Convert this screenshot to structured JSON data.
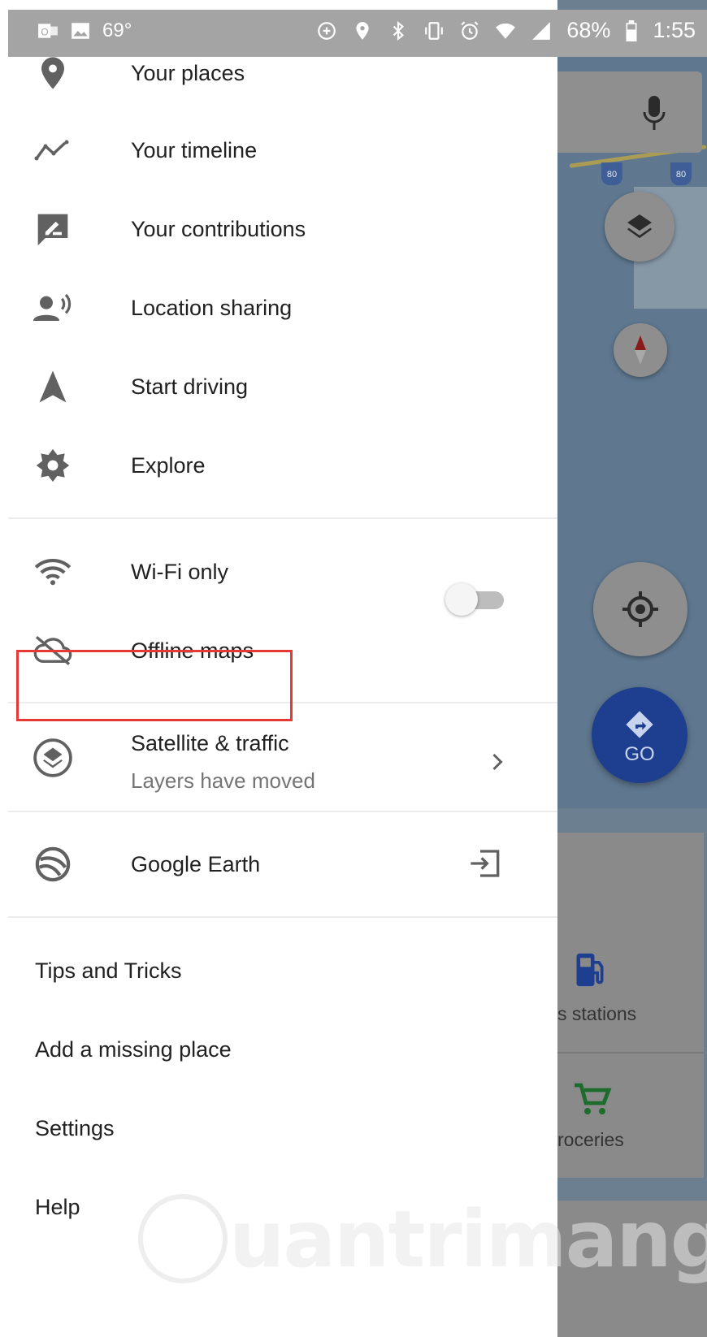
{
  "status_bar": {
    "temperature": "69°",
    "battery": "68%",
    "time": "1:55"
  },
  "drawer": {
    "items": [
      {
        "label": "Your places",
        "icon": "pin-icon"
      },
      {
        "label": "Your timeline",
        "icon": "timeline-icon"
      },
      {
        "label": "Your contributions",
        "icon": "contributions-icon"
      },
      {
        "label": "Location sharing",
        "icon": "location-sharing-icon"
      },
      {
        "label": "Start driving",
        "icon": "navigation-arrow-icon"
      },
      {
        "label": "Explore",
        "icon": "explore-icon"
      }
    ],
    "wifi_only": {
      "label": "Wi-Fi only",
      "icon": "wifi-icon",
      "enabled": false
    },
    "offline_maps": {
      "label": "Offline maps",
      "icon": "cloud-off-icon"
    },
    "satellite": {
      "label": "Satellite & traffic",
      "sublabel": "Layers have moved",
      "icon": "layers-circle-icon"
    },
    "google_earth": {
      "label": "Google Earth",
      "icon": "earth-icon"
    },
    "footer_links": [
      "Tips and Tricks",
      "Add a missing place",
      "Settings",
      "Help"
    ]
  },
  "map": {
    "highway_shield": "80",
    "go_label": "GO",
    "categories": [
      "s stations",
      "roceries"
    ]
  },
  "watermark": "uantrimang"
}
